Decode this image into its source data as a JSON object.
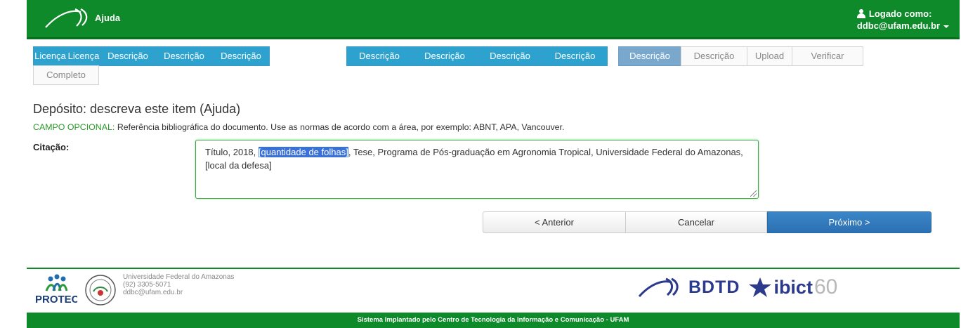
{
  "navbar": {
    "title": "Ajuda",
    "logged_as": "Logado como:",
    "user_email": "ddbc@ufam.edu.br"
  },
  "steps": [
    {
      "label": "Licença",
      "state": "done"
    },
    {
      "label": "Licença",
      "state": "done"
    },
    {
      "label": "Descrição",
      "state": "done"
    },
    {
      "label": "Descrição",
      "state": "done"
    },
    {
      "label": "Descrição",
      "state": "done"
    },
    {
      "label": "Descrição",
      "state": "done"
    },
    {
      "label": "Descrição",
      "state": "done"
    },
    {
      "label": "Descrição",
      "state": "done"
    },
    {
      "label": "Descrição",
      "state": "done"
    },
    {
      "label": "Descrição",
      "state": "current"
    },
    {
      "label": "Descrição",
      "state": "future"
    },
    {
      "label": "Upload",
      "state": "future"
    },
    {
      "label": "Verificar",
      "state": "future"
    },
    {
      "label": "Completo",
      "state": "future"
    }
  ],
  "page_title": "Depósito: descreva este item (Ajuda)",
  "hint": {
    "optional": "CAMPO OPCIONAL:",
    "text": "Referência bibliográfica do documento. Use as normas de acordo com a área, por exemplo: ABNT, APA, Vancouver."
  },
  "citation": {
    "label": "Citação:",
    "before": "Título, 2018, ",
    "selected": "[quantidade de folhas]",
    "after": ", Tese, Programa de Pós-graduação em Agronomia Tropical, Universidade Federal do Amazonas, [local da defesa]"
  },
  "buttons": {
    "previous": "< Anterior",
    "cancel": "Cancelar",
    "next": "Próximo >"
  },
  "footer": {
    "protec_logo_text": "PROTEC",
    "university": "Universidade Federal do Amazonas",
    "phone": "(92) 3305-5071",
    "email": "ddbc@ufam.edu.br",
    "bdtd": "BDTD",
    "ibict": "ibict",
    "sixty": "60",
    "bottom_text": "Sistema Implantado pelo Centro de Tecnologia da Informação e Comunicação - UFAM"
  },
  "colors": {
    "navbar_green": "#0e8a2a",
    "step_done": "#2ea2cf",
    "step_current": "#7aa7cc",
    "next_button": "#2c70b2",
    "optional_green": "#2a9a2a"
  }
}
